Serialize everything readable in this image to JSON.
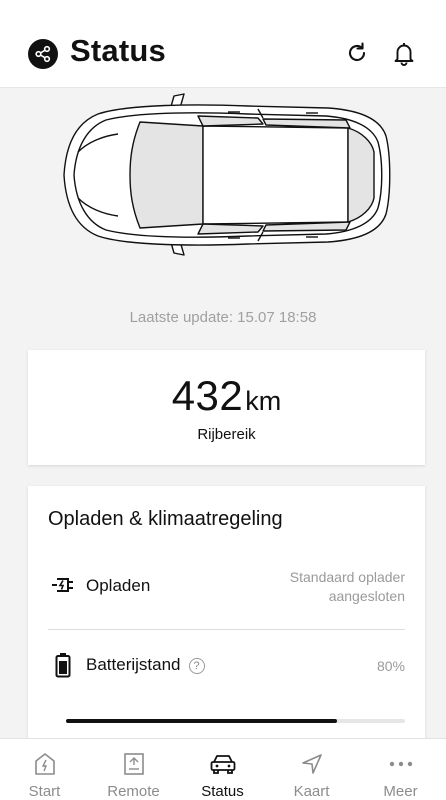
{
  "header": {
    "title": "Status",
    "icons": {
      "share": "share-icon",
      "refresh": "refresh-icon",
      "notifications": "bell-icon"
    }
  },
  "vehicle": {
    "image": "car-top-view"
  },
  "last_update": {
    "label": "Laatste update:",
    "value": "15.07 18:58"
  },
  "range": {
    "value": "432",
    "unit": "km",
    "label": "Rijbereik"
  },
  "charge_climate": {
    "title": "Opladen & klimaatregeling",
    "charging": {
      "label": "Opladen",
      "status_line1": "Standaard oplader",
      "status_line2": "aangesloten",
      "icon": "charging-plug-icon"
    },
    "battery": {
      "label": "Batterijstand",
      "value": "80%",
      "level": 0.8,
      "icon": "battery-icon",
      "help_symbol": "?"
    }
  },
  "bottom_nav": {
    "items": [
      {
        "label": "Start",
        "icon": "home-icon",
        "active": false
      },
      {
        "label": "Remote",
        "icon": "remote-icon",
        "active": false
      },
      {
        "label": "Status",
        "icon": "car-icon",
        "active": true
      },
      {
        "label": "Kaart",
        "icon": "navigation-icon",
        "active": false
      },
      {
        "label": "Meer",
        "icon": "more-icon",
        "active": false
      }
    ]
  },
  "colors": {
    "accent": "#111111",
    "muted": "#9a9a9a",
    "background": "#f3f3f3"
  }
}
